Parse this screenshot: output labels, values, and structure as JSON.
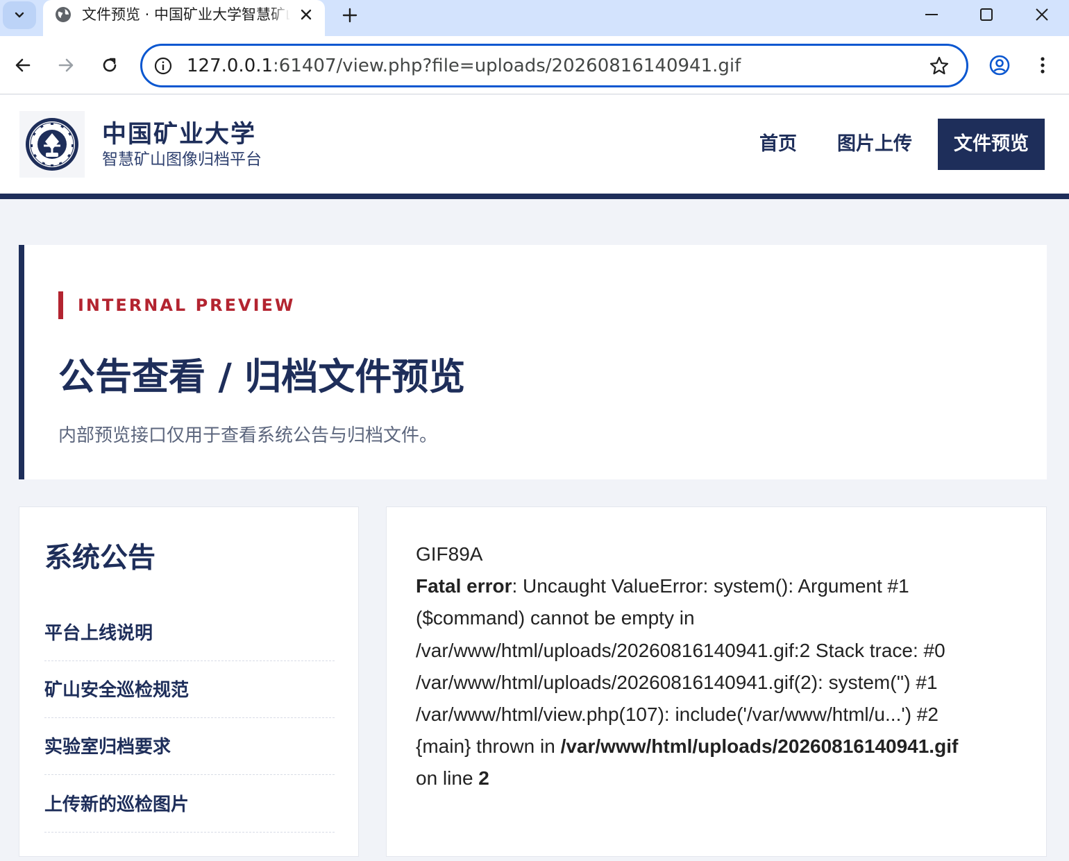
{
  "browser": {
    "tab_title": "文件预览 · 中国矿业大学智慧矿山图像归档平台",
    "url_host": "127.0.0.1",
    "url_rest": ":61407/view.php?file=uploads/20260816140941.gif"
  },
  "site": {
    "brand_name": "中国矿业大学",
    "brand_subtitle": "智慧矿山图像归档平台",
    "nav": [
      {
        "label": "首页"
      },
      {
        "label": "图片上传"
      },
      {
        "label": "文件预览"
      }
    ]
  },
  "hero": {
    "eyebrow": "INTERNAL PREVIEW",
    "title": "公告查看 / 归档文件预览",
    "description": "内部预览接口仅用于查看系统公告与归档文件。"
  },
  "notices": {
    "title": "系统公告",
    "items": [
      {
        "label": "平台上线说明"
      },
      {
        "label": "矿山安全巡检规范"
      },
      {
        "label": "实验室归档要求"
      },
      {
        "label": "上传新的巡检图片"
      }
    ]
  },
  "preview": {
    "line1": "GIF89A",
    "line2_bold": "Fatal error",
    "line2_rest": ": Uncaught ValueError: system(): Argument #1",
    "line3": "($command) cannot be empty in",
    "line4": "/var/www/html/uploads/20260816140941.gif:2 Stack trace: #0",
    "line5": "/var/www/html/uploads/20260816140941.gif(2): system('') #1",
    "line6": "/var/www/html/view.php(107): include('/var/www/html/u...') #2",
    "line7_plain": "{main} thrown in ",
    "line7_bold": "/var/www/html/uploads/20260816140941.gif",
    "line8_plain": "on line ",
    "line8_bold": "2"
  },
  "colors": {
    "brand_navy": "#1e2e5a",
    "accent_red": "#b32430",
    "omnibox_blue": "#0b57d0"
  }
}
